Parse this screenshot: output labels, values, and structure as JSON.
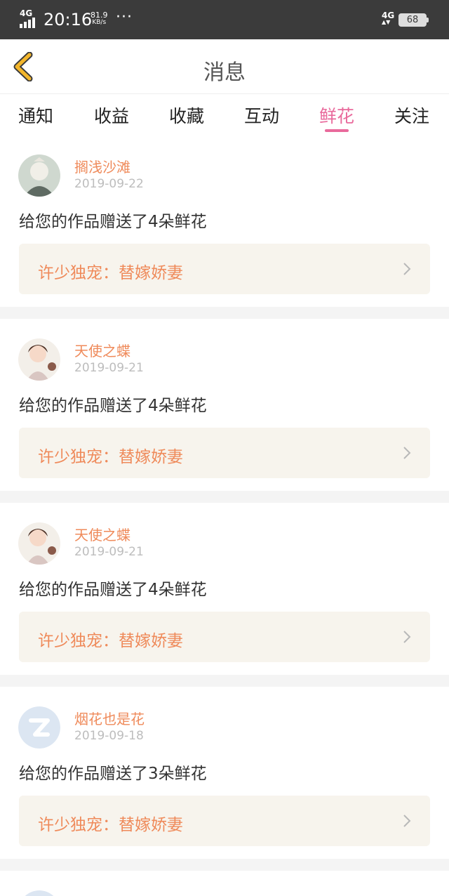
{
  "status_bar": {
    "network": "4G",
    "time": "20:16",
    "speed_value": "81.9",
    "speed_unit": "KB/s",
    "dots": "···",
    "network2": "4G",
    "battery": "68"
  },
  "header": {
    "title": "消息",
    "back_icon": "chevron-left-icon",
    "accent": "#f3b62b"
  },
  "tabs": [
    {
      "label": "通知",
      "active": false
    },
    {
      "label": "收益",
      "active": false
    },
    {
      "label": "收藏",
      "active": false
    },
    {
      "label": "互动",
      "active": false
    },
    {
      "label": "鲜花",
      "active": true
    },
    {
      "label": "关注",
      "active": false
    }
  ],
  "colors": {
    "active_tab": "#e96a9c",
    "name": "#ef8a5a",
    "work_bg": "#f7f4ed"
  },
  "messages": [
    {
      "user": "搁浅沙滩",
      "date": "2019-09-22",
      "text": "给您的作品赠送了4朵鲜花",
      "work": "许少独宠：替嫁娇妻",
      "avatar": "photo-avatar"
    },
    {
      "user": "天使之蝶",
      "date": "2019-09-21",
      "text": "给您的作品赠送了4朵鲜花",
      "work": "许少独宠：替嫁娇妻",
      "avatar": "photo-avatar"
    },
    {
      "user": "天使之蝶",
      "date": "2019-09-21",
      "text": "给您的作品赠送了4朵鲜花",
      "work": "许少独宠：替嫁娇妻",
      "avatar": "photo-avatar"
    },
    {
      "user": "烟花也是花",
      "date": "2019-09-18",
      "text": "给您的作品赠送了3朵鲜花",
      "work": "许少独宠：替嫁娇妻",
      "avatar": "default-avatar"
    }
  ]
}
